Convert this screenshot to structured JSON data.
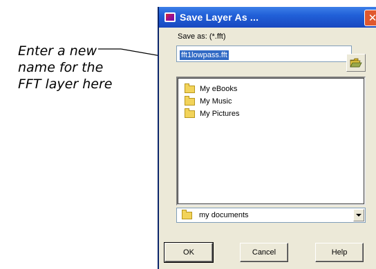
{
  "annotation": {
    "lines": [
      "Enter a new",
      "name for the",
      "FFT layer here"
    ]
  },
  "dialog": {
    "title": "Save Layer As ...",
    "close_glyph": "✕",
    "save_as_label": "Save as: (*.fft)",
    "filename_value": "fft1lowpass.fft",
    "folders": [
      "My eBooks",
      "My Music",
      "My Pictures"
    ],
    "location": "my documents",
    "buttons": {
      "ok": "OK",
      "cancel": "Cancel",
      "help": "Help"
    }
  },
  "icons": {
    "app": "app-icon",
    "close": "close-icon",
    "browse": "open-folder-icon",
    "folder": "folder-icon",
    "dropdown": "chevron-down-icon"
  },
  "colors": {
    "titlebar": "#2160d8",
    "dialog_bg": "#ece9d8",
    "selection": "#316ac5",
    "close": "#e0582e"
  }
}
